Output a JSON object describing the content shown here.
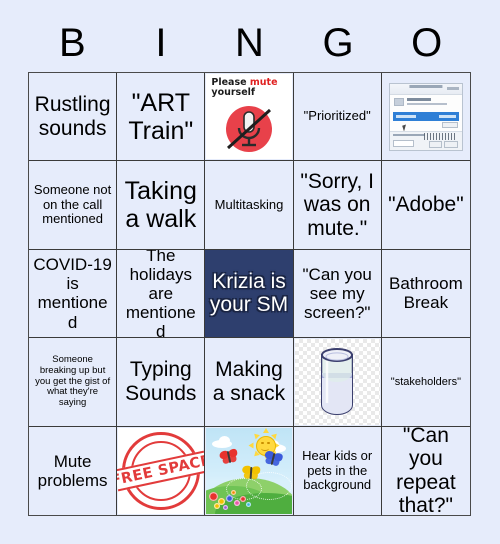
{
  "header": {
    "letters": [
      "B",
      "I",
      "N",
      "G",
      "O"
    ]
  },
  "colors": {
    "page_background": "#e6ecfb",
    "cell_background": "#e6ecfb",
    "cell_border": "#3a3a3a",
    "marked_background": "#2e3f6e",
    "marked_text": "#ffffff",
    "header_text": "#000000",
    "stamp_red": "#e23b3b",
    "mute_red": "#e02020"
  },
  "cells": [
    {
      "id": "b1",
      "type": "text",
      "text": "Rustling sounds",
      "size": "lg",
      "marked": false
    },
    {
      "id": "i1",
      "type": "text",
      "text": "\"ART Train\"",
      "size": "xl",
      "marked": false
    },
    {
      "id": "n1",
      "type": "image",
      "image": "please-mute-yourself",
      "caption_line1": "Please ",
      "caption_highlight": "mute",
      "caption_line2": "yourself",
      "marked": false
    },
    {
      "id": "g1",
      "type": "text",
      "text": "\"Prioritized\"",
      "size": "sm",
      "marked": false
    },
    {
      "id": "o1",
      "type": "image",
      "image": "file-dialog-screenshot",
      "marked": false
    },
    {
      "id": "b2",
      "type": "text",
      "text": "Someone not on the call mentioned",
      "size": "sm",
      "marked": false
    },
    {
      "id": "i2",
      "type": "text",
      "text": "Taking a walk",
      "size": "xl",
      "marked": false
    },
    {
      "id": "n2",
      "type": "text",
      "text": "Multitasking",
      "size": "sm",
      "marked": false
    },
    {
      "id": "g2",
      "type": "text",
      "text": "\"Sorry, I was on mute.\"",
      "size": "lg",
      "marked": false
    },
    {
      "id": "o2",
      "type": "text",
      "text": "\"Adobe\"",
      "size": "lg",
      "marked": false
    },
    {
      "id": "b3",
      "type": "text",
      "text": "COVID-19 is mentioned",
      "size": "md",
      "marked": false
    },
    {
      "id": "i3",
      "type": "text",
      "text": "The holidays are mentioned",
      "size": "md",
      "marked": false
    },
    {
      "id": "n3",
      "type": "text",
      "text": "Krizia is your SM",
      "size": "lg",
      "marked": true
    },
    {
      "id": "g3",
      "type": "text",
      "text": "\"Can you see my screen?\"",
      "size": "md",
      "marked": false
    },
    {
      "id": "o3",
      "type": "text",
      "text": "Bathroom Break",
      "size": "md",
      "marked": false
    },
    {
      "id": "b4",
      "type": "text",
      "text": "Someone breaking up but you get the gist of what they're saying",
      "size": "xxs",
      "marked": false
    },
    {
      "id": "i4",
      "type": "text",
      "text": "Typing Sounds",
      "size": "lg",
      "marked": false
    },
    {
      "id": "n4",
      "type": "text",
      "text": "Making a snack",
      "size": "lg",
      "marked": false
    },
    {
      "id": "g4",
      "type": "image",
      "image": "glass-of-water",
      "marked": false
    },
    {
      "id": "o4",
      "type": "text",
      "text": "\"stakeholders\"",
      "size": "xs",
      "marked": false
    },
    {
      "id": "b5",
      "type": "text",
      "text": "Mute problems",
      "size": "md",
      "marked": false
    },
    {
      "id": "i5",
      "type": "image",
      "image": "free-space-stamp",
      "stamp_text": "FREE SPACE",
      "marked": false
    },
    {
      "id": "n5",
      "type": "image",
      "image": "spring-meadow-scene",
      "marked": false
    },
    {
      "id": "g5",
      "type": "text",
      "text": "Hear kids or pets in the background",
      "size": "sm",
      "marked": false
    },
    {
      "id": "o5",
      "type": "text",
      "text": "\"Can you repeat that?\"",
      "size": "lg",
      "marked": false
    }
  ]
}
